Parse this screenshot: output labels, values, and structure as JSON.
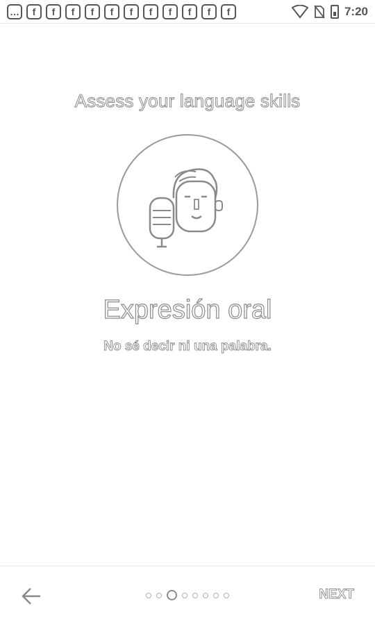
{
  "status_bar": {
    "notification_icons": [
      "chat-icon",
      "facebook-icon",
      "facebook-icon",
      "facebook-icon",
      "facebook-icon",
      "facebook-icon",
      "facebook-icon",
      "facebook-icon",
      "facebook-icon",
      "facebook-icon",
      "facebook-icon",
      "facebook-icon"
    ],
    "notification_glyphs": [
      "…",
      "f",
      "f",
      "f",
      "f",
      "f",
      "f",
      "f",
      "f",
      "f",
      "f",
      "f"
    ],
    "time": "7:20"
  },
  "heading": "Assess your language skills",
  "skill": {
    "icon": "speaking-person-microphone-icon",
    "title": "Expresión oral",
    "subtitle": "No sé decir ni una palabra."
  },
  "footer": {
    "back_icon": "arrow-left-icon",
    "page_dots_total": 8,
    "page_dots_active_index": 2,
    "next_label": "NEXT"
  }
}
